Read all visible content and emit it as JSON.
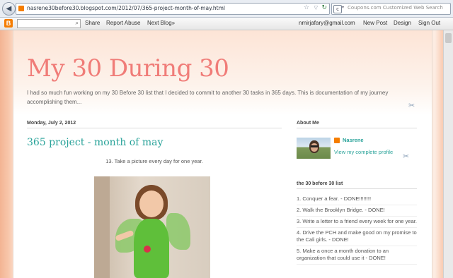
{
  "browser": {
    "url": "nasrene30before30.blogspot.com/2012/07/365-project-month-of-may.html",
    "search_placeholder": "Coupons.com Customized Web Search"
  },
  "navbar": {
    "logo": "B",
    "links": {
      "share": "Share",
      "report": "Report Abuse",
      "next_blog": "Next Blog»"
    },
    "email": "nmirjafary@gmail.com",
    "new_post": "New Post",
    "design": "Design",
    "sign_out": "Sign Out"
  },
  "header": {
    "title": "My 30 During 30",
    "description": "I had so much fun working on my 30 Before 30 list that I decided to commit to another 30 tasks in 365 days. This is documentation of my journey accomplishing them..."
  },
  "post": {
    "date": "Monday, July 2, 2012",
    "title": "365 project - month of may",
    "body": "13. Take a picture every day for one year."
  },
  "sidebar": {
    "about_title": "About Me",
    "profile_name": "Nasrene",
    "profile_link": "View my complete profile",
    "list_title": "the 30 before 30 list",
    "items": [
      "1. Conquer a fear. - DONE!!!!!!!!",
      "2. Walk the Brooklyn Bridge. - DONE!",
      "3. Write a letter to a friend every week for one year.",
      "4. Drive the PCH and make good on my promise to the Cali girls. - DONE!",
      "5. Make a once a month donation to an organization that could use it - DONE!"
    ]
  }
}
